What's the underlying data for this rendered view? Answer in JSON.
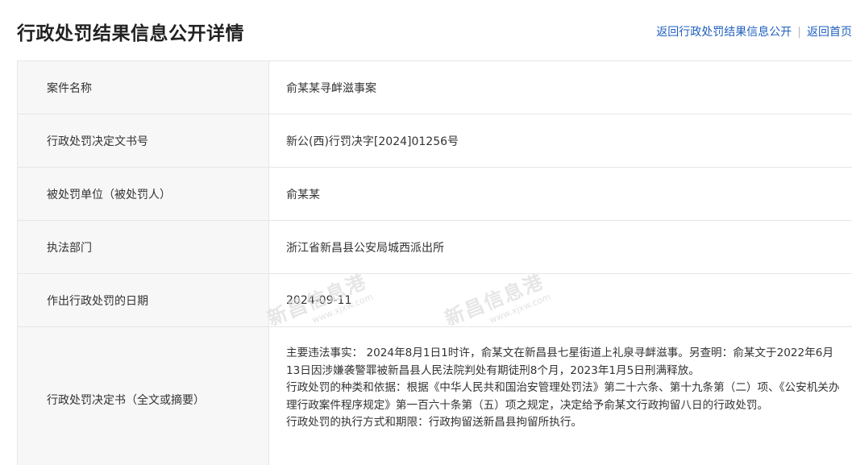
{
  "header": {
    "title": "行政处罚结果信息公开详情",
    "link_back_list": "返回行政处罚结果信息公开",
    "separator": "|",
    "link_home": "返回首页"
  },
  "details": {
    "case_name": {
      "label": "案件名称",
      "value": "俞某某寻衅滋事案"
    },
    "decision_number": {
      "label": "行政处罚决定文书号",
      "value": "新公(西)行罚决字[2024]01256号"
    },
    "punished_party": {
      "label": "被处罚单位（被处罚人）",
      "value": "俞某某"
    },
    "enforcement_dept": {
      "label": "执法部门",
      "value": "浙江省新昌县公安局城西派出所"
    },
    "decision_date": {
      "label": "作出行政处罚的日期",
      "value": "2024-09-11"
    },
    "decision_text": {
      "label": "行政处罚决定书（全文或摘要）",
      "paragraph1": "主要违法事实： 2024年8月1日1时许，俞某文在新昌县七星街道上礼泉寻衅滋事。另查明：俞某文于2022年6月13日因涉嫌袭警罪被新昌县人民法院判处有期徒刑8个月，2023年1月5日刑满释放。",
      "paragraph2": "行政处罚的种类和依据：根据《中华人民共和国治安管理处罚法》第二十六条、第十九条第（二）项、《公安机关办理行政案件程序规定》第一百六十条第（五）项之规定，决定给予俞某文行政拘留八日的行政处罚。",
      "paragraph3": "行政处罚的执行方式和期限：行政拘留送新昌县拘留所执行。"
    }
  },
  "watermark": {
    "text": "新昌信息港",
    "url": "www.xjxw.com"
  }
}
